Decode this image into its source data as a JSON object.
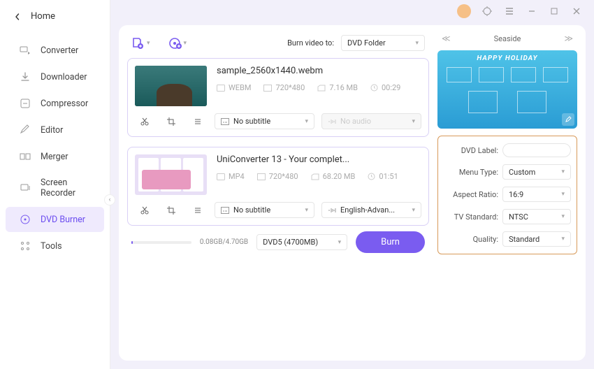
{
  "home": "Home",
  "sidebar": {
    "items": [
      {
        "label": "Converter"
      },
      {
        "label": "Downloader"
      },
      {
        "label": "Compressor"
      },
      {
        "label": "Editor"
      },
      {
        "label": "Merger"
      },
      {
        "label": "Screen Recorder"
      },
      {
        "label": "DVD Burner"
      },
      {
        "label": "Tools"
      }
    ]
  },
  "toolbar": {
    "burn_to_label": "Burn video to:",
    "burn_to_value": "DVD Folder"
  },
  "videos": [
    {
      "title": "sample_2560x1440.webm",
      "format": "WEBM",
      "resolution": "720*480",
      "size": "7.16 MB",
      "duration": "00:29",
      "subtitle": "No subtitle",
      "audio": "No audio",
      "audio_disabled": true
    },
    {
      "title": "UniConverter 13 - Your complet...",
      "format": "MP4",
      "resolution": "720*480",
      "size": "68.20 MB",
      "duration": "01:51",
      "subtitle": "No subtitle",
      "audio": "English-Advan...",
      "audio_disabled": false
    }
  ],
  "theme": {
    "name": "Seaside",
    "banner_text": "HAPPY HOLIDAY"
  },
  "settings": {
    "dvd_label_label": "DVD Label:",
    "dvd_label_value": "",
    "menu_type_label": "Menu Type:",
    "menu_type_value": "Custom",
    "aspect_label": "Aspect Ratio:",
    "aspect_value": "16:9",
    "tv_label": "TV Standard:",
    "tv_value": "NTSC",
    "quality_label": "Quality:",
    "quality_value": "Standard"
  },
  "bottom": {
    "progress_text": "0.08GB/4.70GB",
    "disc_value": "DVD5 (4700MB)",
    "burn_label": "Burn"
  }
}
